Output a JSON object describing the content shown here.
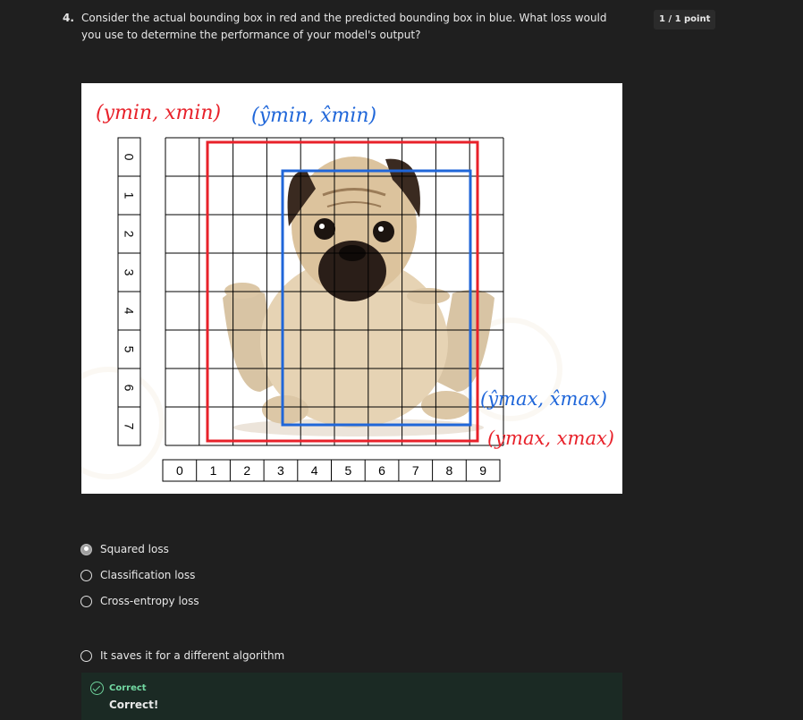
{
  "question": {
    "number": "4.",
    "text": "Consider the actual bounding box in red and the predicted bounding box in blue. What loss would you use to determine the performance of your model's output?",
    "points": "1 / 1 point"
  },
  "figure": {
    "label_min_actual": "(ymin, xmin)",
    "label_min_pred": "(ŷmin, x̂min)",
    "label_max_pred": "(ŷmax, x̂max)",
    "label_max_actual": "(ymax, xmax)",
    "row_indices": [
      "0",
      "1",
      "2",
      "3",
      "4",
      "5",
      "6",
      "7"
    ],
    "col_indices": [
      "0",
      "1",
      "2",
      "3",
      "4",
      "5",
      "6",
      "7",
      "8",
      "9"
    ],
    "actual_box_color": "#e8212a",
    "predicted_box_color": "#1f66d9"
  },
  "options": [
    {
      "label": "Squared loss",
      "selected": true
    },
    {
      "label": "Classification loss",
      "selected": false
    },
    {
      "label": "Cross-entropy loss",
      "selected": false
    },
    {
      "label": "It saves it for a different algorithm",
      "selected": false
    }
  ],
  "feedback": {
    "status": "Correct",
    "message": "Correct!",
    "color": "#72d9a2"
  }
}
